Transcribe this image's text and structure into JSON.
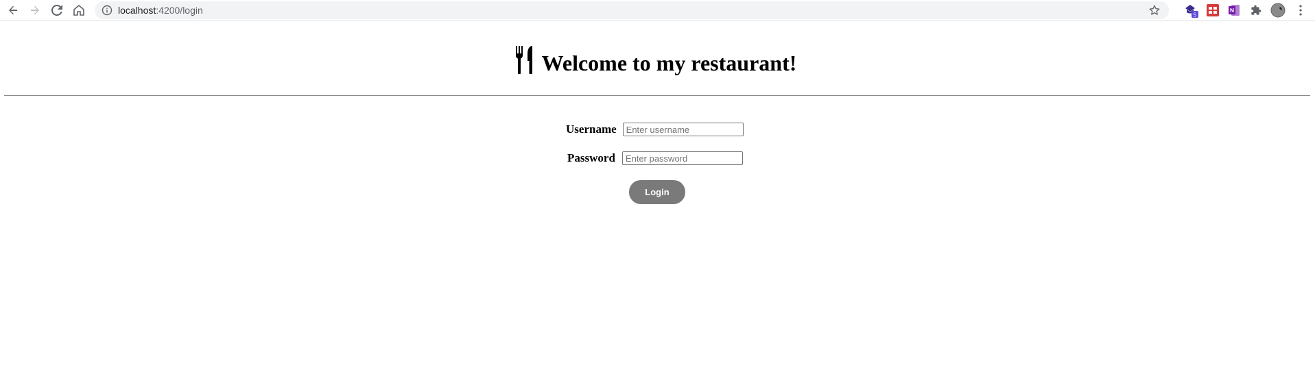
{
  "browser": {
    "url_host": "localhost",
    "url_rest": ":4200/login",
    "extensions": [
      "teams-icon",
      "calendar-extension-icon",
      "onenote-icon",
      "puzzle-icon",
      "profile-avatar"
    ],
    "extension_badge": "5"
  },
  "page": {
    "title": "Welcome to my restaurant!",
    "logo_icon": "fork-knife-icon"
  },
  "login_form": {
    "username_label": "Username",
    "username_placeholder": "Enter username",
    "username_value": "",
    "password_label": "Password",
    "password_placeholder": "Enter password",
    "password_value": "",
    "submit_label": "Login"
  },
  "colors": {
    "button_bg": "#7a7a7a",
    "button_text": "#ffffff",
    "divider": "#8a8a8a"
  }
}
